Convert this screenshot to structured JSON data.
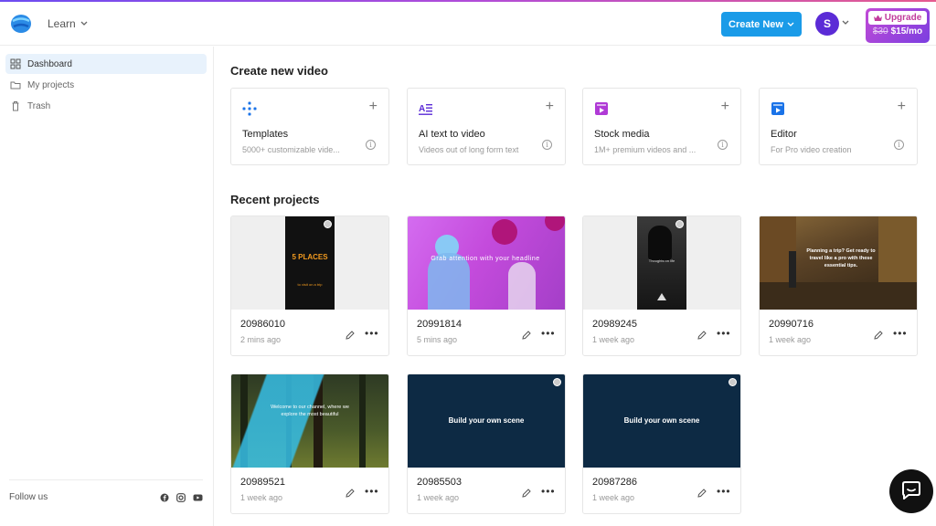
{
  "header": {
    "learn_label": "Learn",
    "create_new_label": "Create New",
    "avatar_initial": "S",
    "upgrade_label": "Upgrade",
    "upgrade_old_price": "$30",
    "upgrade_new_price": "$15/mo"
  },
  "sidebar": {
    "items": [
      {
        "label": "Dashboard",
        "icon": "grid-icon"
      },
      {
        "label": "My projects",
        "icon": "folder-icon"
      },
      {
        "label": "Trash",
        "icon": "trash-icon"
      }
    ],
    "follow_label": "Follow us",
    "socials": [
      "facebook-icon",
      "instagram-icon",
      "youtube-icon"
    ]
  },
  "create": {
    "title": "Create new video",
    "cards": [
      {
        "title": "Templates",
        "subtitle": "5000+ customizable vide...",
        "icon": "templates-icon"
      },
      {
        "title": "AI text to video",
        "subtitle": "Videos out of long form text",
        "icon": "ai-text-icon"
      },
      {
        "title": "Stock media",
        "subtitle": "1M+ premium videos and ...",
        "icon": "stock-media-icon"
      },
      {
        "title": "Editor",
        "subtitle": "For Pro video creation",
        "icon": "editor-icon"
      }
    ]
  },
  "recent": {
    "title": "Recent projects",
    "projects": [
      {
        "name": "20986010",
        "time": "2 mins ago",
        "thumb_text": "5 PLACES",
        "thumb_sub": "to visit on a trip"
      },
      {
        "name": "20991814",
        "time": "5 mins ago",
        "thumb_text": "Grab attention with your headline"
      },
      {
        "name": "20989245",
        "time": "1 week ago",
        "thumb_text": "Thoughts on life"
      },
      {
        "name": "20990716",
        "time": "1 week ago",
        "thumb_text": "Planning a trip? Get ready to travel like a pro with these essential tips."
      },
      {
        "name": "20989521",
        "time": "1 week ago",
        "thumb_text": "Welcome to our channel, where we explore the most beautiful"
      },
      {
        "name": "20985503",
        "time": "1 week ago",
        "thumb_text": "Build your own scene"
      },
      {
        "name": "20987286",
        "time": "1 week ago",
        "thumb_text": "Build your own scene"
      }
    ]
  },
  "colors": {
    "accent": "#1a9be8",
    "avatar": "#5b2bd6",
    "upgrade_gradient_start": "#c24bd6",
    "upgrade_gradient_end": "#7b3ee0"
  }
}
